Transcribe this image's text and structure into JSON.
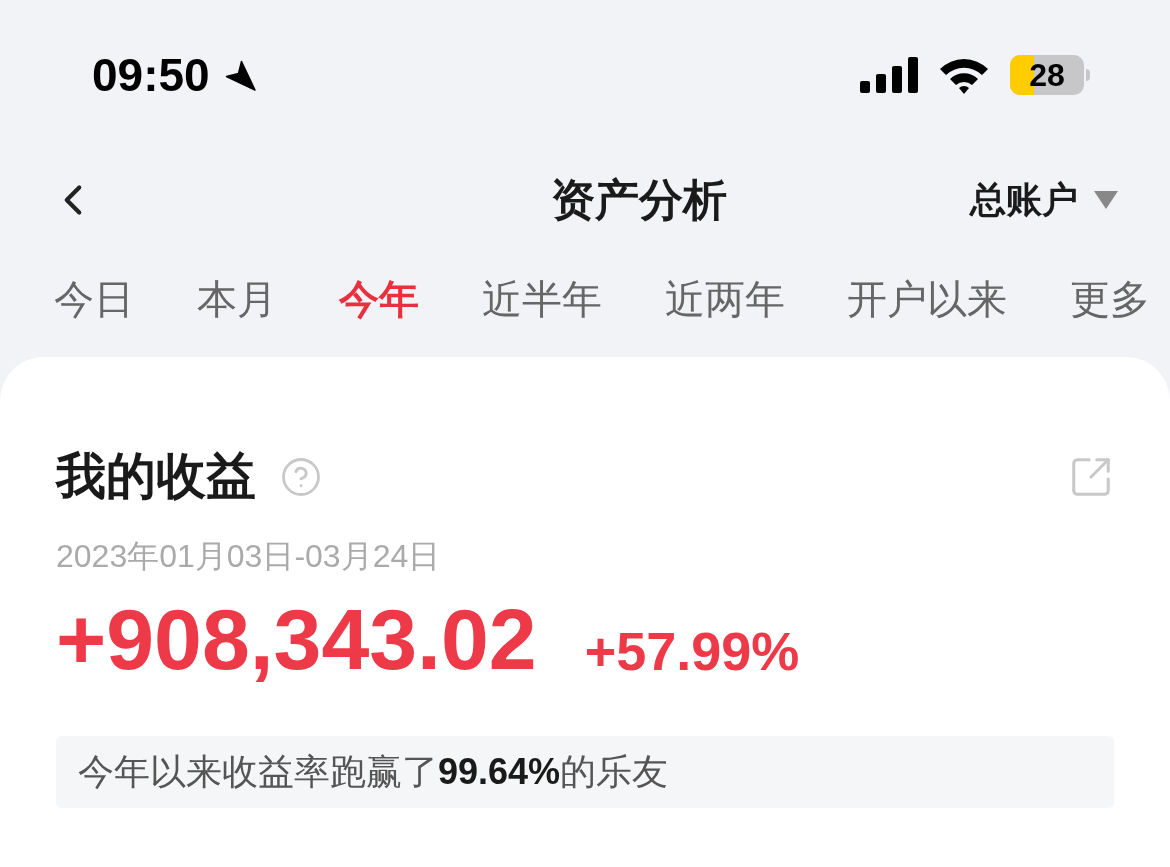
{
  "status_bar": {
    "time": "09:50",
    "battery": "28"
  },
  "nav": {
    "title": "资产分析",
    "account": "总账户"
  },
  "tabs": [
    {
      "label": "今日",
      "selected": false
    },
    {
      "label": "本月",
      "selected": false
    },
    {
      "label": "今年",
      "selected": true
    },
    {
      "label": "近半年",
      "selected": false
    },
    {
      "label": "近两年",
      "selected": false
    },
    {
      "label": "开户以来",
      "selected": false
    },
    {
      "label": "更多",
      "selected": false
    }
  ],
  "card": {
    "title": "我的收益",
    "date_range": "2023年01月03日-03月24日",
    "profit": "+908,343.02",
    "rate": "+57.99%",
    "rank_note": "今年以来收益率跑赢了**99.64%**的乐友"
  }
}
